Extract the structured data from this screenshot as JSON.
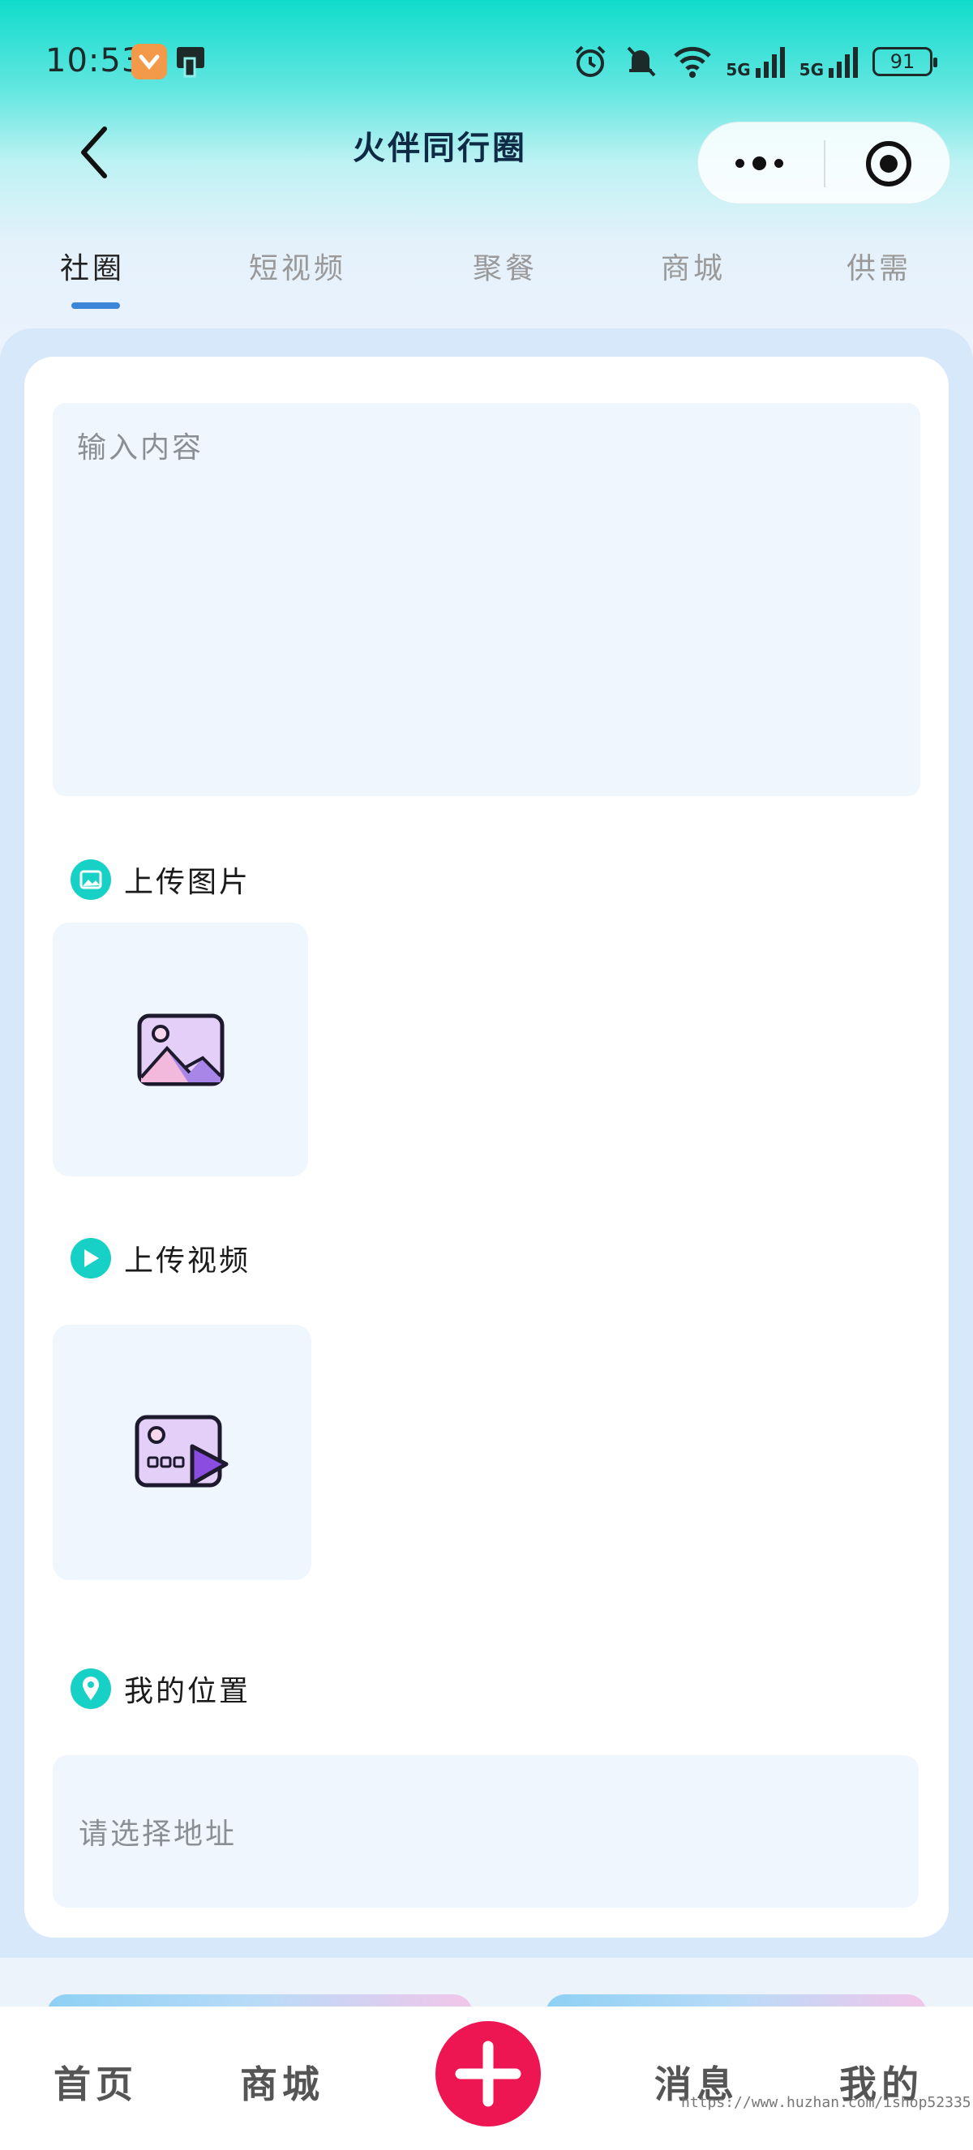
{
  "status_bar": {
    "time": "10:53",
    "network_1": "5G",
    "network_2": "5G",
    "battery": "91"
  },
  "nav": {
    "title": "火伴同行圈"
  },
  "tabs": [
    {
      "label": "社圈",
      "active": true
    },
    {
      "label": "短视频",
      "active": false
    },
    {
      "label": "聚餐",
      "active": false
    },
    {
      "label": "商城",
      "active": false
    },
    {
      "label": "供需",
      "active": false
    }
  ],
  "form": {
    "content_placeholder": "输入内容",
    "upload_image_label": "上传图片",
    "upload_video_label": "上传视频",
    "location_label": "我的位置",
    "address_placeholder": "请选择地址"
  },
  "bottom_bar": {
    "home": "首页",
    "mall": "商城",
    "messages": "消息",
    "mine": "我的"
  },
  "watermark": "https://www.huzhan.com/ishop52335",
  "colors": {
    "accent_teal": "#17d1c6",
    "tab_indicator": "#3b86d9",
    "add_button": "#ee1553",
    "card_bg": "#f0f6fd"
  }
}
